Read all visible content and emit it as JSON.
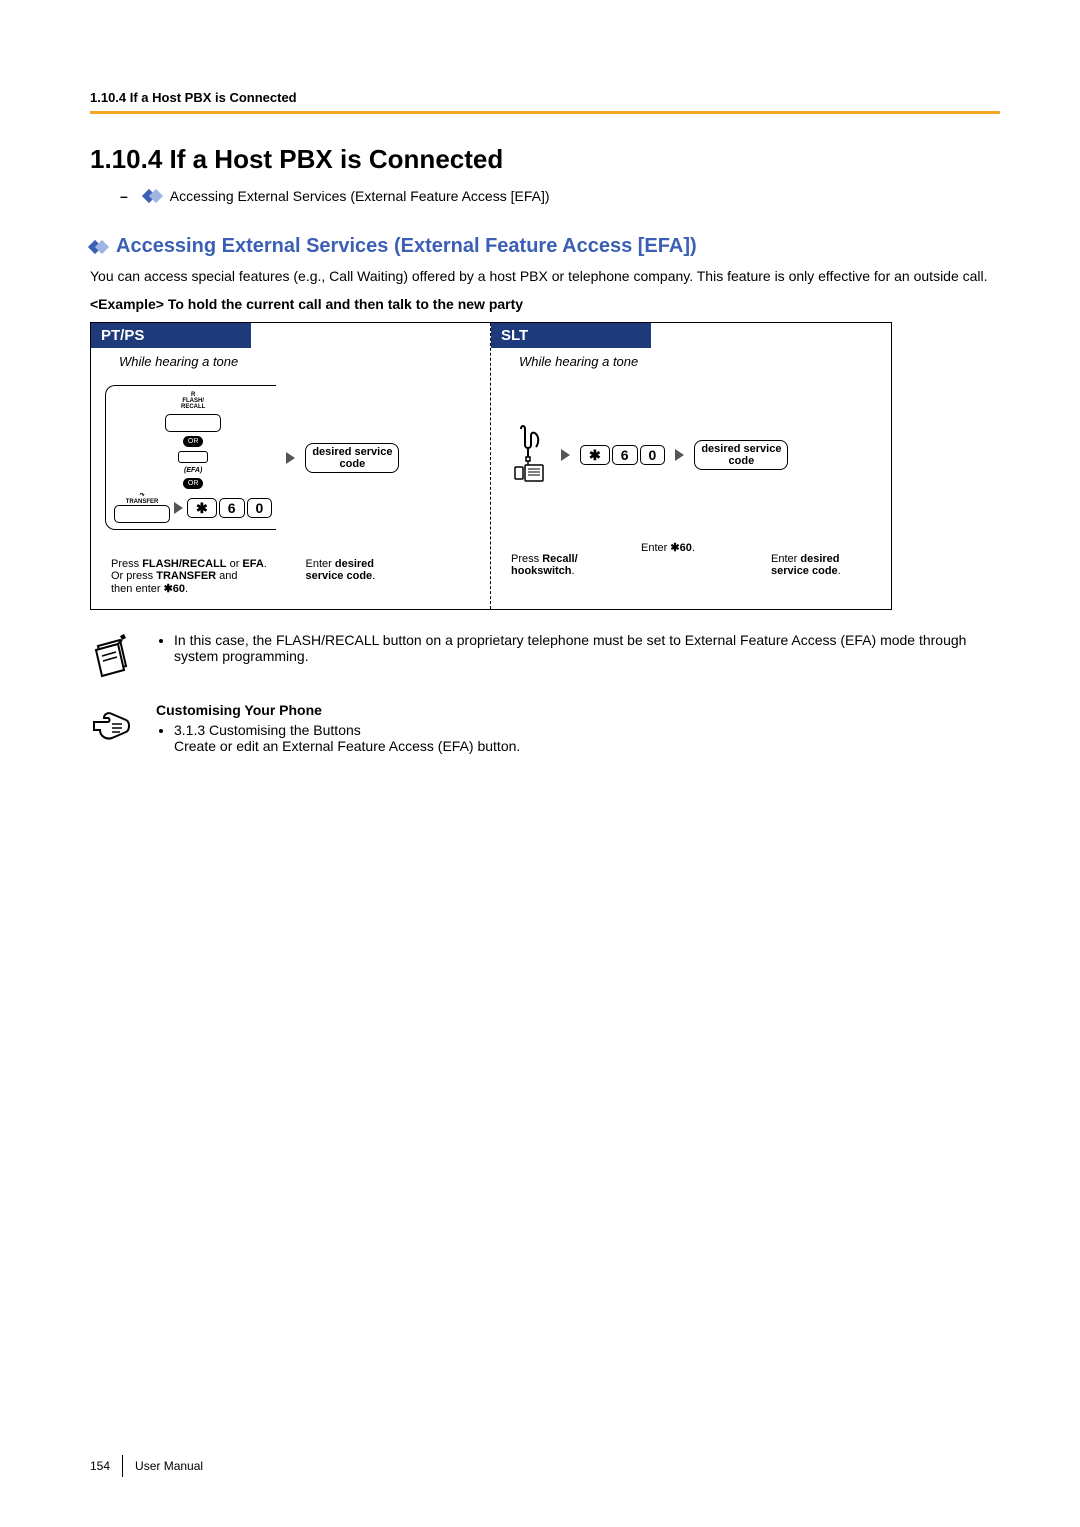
{
  "header": {
    "section_ref": "1.10.4 If a Host PBX is Connected"
  },
  "title": "1.10.4  If a Host PBX is Connected",
  "link_item": "Accessing External Services (External Feature Access [EFA])",
  "sub_heading": "Accessing External Services (External Feature Access [EFA])",
  "intro": "You can access special features (e.g., Call Waiting) offered by a host PBX or telephone company. This feature is only effective for an outside call.",
  "example_title": "<Example> To hold the current call and then talk to the new party",
  "diagram": {
    "left": {
      "header": "PT/PS",
      "subcaption": "While hearing a tone",
      "recall_top": "R",
      "recall_bottom": "FLASH/\nRECALL",
      "or": "OR",
      "efa": "(EFA)",
      "transfer": "TRANSFER",
      "keys": {
        "star": "✱",
        "six": "6",
        "zero": "0"
      },
      "service": "desired service\ncode",
      "instr1_a": "Press ",
      "instr1_b": "FLASH/RECALL",
      "instr1_c": " or ",
      "instr1_d": "EFA",
      "instr1_e": ".\nOr press ",
      "instr1_f": "TRANSFER",
      "instr1_g": " and\nthen enter ",
      "instr1_h": "✱60",
      "instr1_i": ".",
      "instr2_a": "Enter ",
      "instr2_b": "desired\nservice code",
      "instr2_c": "."
    },
    "right": {
      "header": "SLT",
      "subcaption": "While hearing a tone",
      "keys": {
        "star": "✱",
        "six": "6",
        "zero": "0"
      },
      "service": "desired service\ncode",
      "instr1_a": "Press ",
      "instr1_b": "Recall/\nhookswitch",
      "instr1_c": ".",
      "instr2_a": "Enter ",
      "instr2_b": "✱60",
      "instr2_c": ".",
      "instr3_a": "Enter ",
      "instr3_b": "desired\nservice code",
      "instr3_c": "."
    }
  },
  "note1": "In this case, the FLASH/RECALL button on a proprietary telephone must be set to External Feature Access (EFA) mode through system programming.",
  "customise": {
    "title": "Customising Your Phone",
    "item_ref": "3.1.3  Customising the Buttons",
    "item_desc": "Create or edit an External Feature Access (EFA) button."
  },
  "footer": {
    "page": "154",
    "label": "User Manual"
  }
}
